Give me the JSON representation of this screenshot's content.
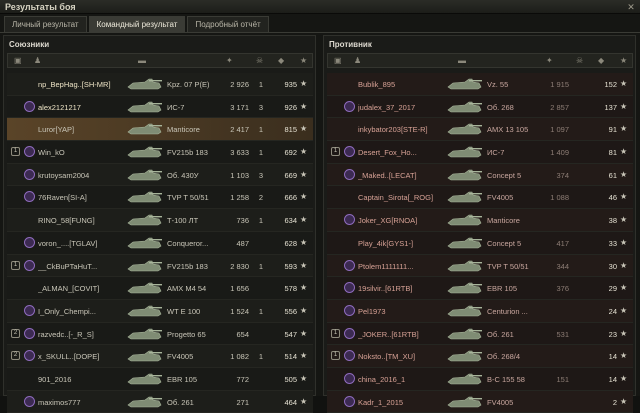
{
  "window": {
    "title": "Результаты боя",
    "close_icon": "close-icon"
  },
  "tabs": [
    {
      "label": "Личный результат",
      "active": false
    },
    {
      "label": "Командный результат",
      "active": true
    },
    {
      "label": "Подробный отчёт",
      "active": false
    }
  ],
  "allies": {
    "title": "Союзники",
    "rows": [
      {
        "name": "np_BepHag..[SH-MR]",
        "tank": "Kpz. 07 P(E)",
        "damage": "2 926",
        "frags": "1",
        "xp": "935",
        "platoon": "",
        "badge": false
      },
      {
        "name": "alex2121217",
        "tank": "ИС-7",
        "damage": "3 171",
        "frags": "3",
        "xp": "926",
        "platoon": "",
        "badge": true
      },
      {
        "name": "Luror[YAP]",
        "tank": "Manticore",
        "damage": "2 417",
        "frags": "1",
        "xp": "815",
        "platoon": "",
        "badge": false,
        "me": true
      },
      {
        "name": "Win_kO",
        "tank": "FV215b 183",
        "damage": "3 633",
        "frags": "1",
        "xp": "692",
        "platoon": "1",
        "badge": true
      },
      {
        "name": "krutoysam2004",
        "tank": "Об. 430У",
        "damage": "1 103",
        "frags": "3",
        "xp": "669",
        "platoon": "",
        "badge": true
      },
      {
        "name": "76Raven[SI-A]",
        "tank": "TVP T 50/51",
        "damage": "1 258",
        "frags": "2",
        "xp": "666",
        "platoon": "",
        "badge": true
      },
      {
        "name": "RINO_58[FUNG]",
        "tank": "Т-100 ЛТ",
        "damage": "736",
        "frags": "1",
        "xp": "634",
        "platoon": "",
        "badge": false
      },
      {
        "name": "voron_....[TGLAV]",
        "tank": "Conqueror...",
        "damage": "487",
        "frags": "",
        "xp": "628",
        "platoon": "",
        "badge": true
      },
      {
        "name": "__CkBuPTaHuT...",
        "tank": "FV215b 183",
        "damage": "2 830",
        "frags": "1",
        "xp": "593",
        "platoon": "1",
        "badge": true
      },
      {
        "name": "_ALMAN_[COVIT]",
        "tank": "AMX M4 54",
        "damage": "1 656",
        "frags": "",
        "xp": "578",
        "platoon": "",
        "badge": false
      },
      {
        "name": "I_Only_Chempi...",
        "tank": "WT E 100",
        "damage": "1 524",
        "frags": "1",
        "xp": "556",
        "platoon": "",
        "badge": true
      },
      {
        "name": "razvedc..[-_R_S]",
        "tank": "Progetto 65",
        "damage": "654",
        "frags": "",
        "xp": "547",
        "platoon": "2",
        "badge": true
      },
      {
        "name": "x_SKULL..[DOPE]",
        "tank": "FV4005",
        "damage": "1 082",
        "frags": "1",
        "xp": "514",
        "platoon": "2",
        "badge": true
      },
      {
        "name": "901_2016",
        "tank": "EBR 105",
        "damage": "772",
        "frags": "",
        "xp": "505",
        "platoon": "",
        "badge": false
      },
      {
        "name": "maximos777",
        "tank": "Об. 261",
        "damage": "271",
        "frags": "",
        "xp": "464",
        "platoon": "",
        "badge": true
      }
    ]
  },
  "enemies": {
    "title": "Противник",
    "rows": [
      {
        "name": "Bublik_895",
        "tank": "Vz. 55",
        "damage": "1 915",
        "frags": "",
        "xp": "152",
        "platoon": "",
        "badge": false
      },
      {
        "name": "judalex_37_2017",
        "tank": "Об. 268",
        "damage": "2 857",
        "frags": "",
        "xp": "137",
        "platoon": "",
        "badge": true
      },
      {
        "name": "inkybator203[STE-R]",
        "tank": "AMX 13 105",
        "damage": "1 097",
        "frags": "",
        "xp": "91",
        "platoon": "",
        "badge": false
      },
      {
        "name": "Desert_Fox_Ho...",
        "tank": "ИС-7",
        "damage": "1 409",
        "frags": "",
        "xp": "81",
        "platoon": "1",
        "badge": true
      },
      {
        "name": "_Maked..[LECAT]",
        "tank": "Concept 5",
        "damage": "374",
        "frags": "",
        "xp": "61",
        "platoon": "",
        "badge": true
      },
      {
        "name": "Captain_Sirota[_ROG]",
        "tank": "FV4005",
        "damage": "1 088",
        "frags": "",
        "xp": "46",
        "platoon": "",
        "badge": false
      },
      {
        "name": "Joker_XG[RNOA]",
        "tank": "Manticore",
        "damage": "",
        "frags": "",
        "xp": "38",
        "platoon": "",
        "badge": true
      },
      {
        "name": "Play_4ik[GYS1-]",
        "tank": "Concept 5",
        "damage": "417",
        "frags": "",
        "xp": "33",
        "platoon": "",
        "badge": false
      },
      {
        "name": "Ptolem1111111...",
        "tank": "TVP T 50/51",
        "damage": "344",
        "frags": "",
        "xp": "30",
        "platoon": "",
        "badge": true
      },
      {
        "name": "19silvir..[61RTB]",
        "tank": "EBR 105",
        "damage": "376",
        "frags": "",
        "xp": "29",
        "platoon": "",
        "badge": true
      },
      {
        "name": "Pel1973",
        "tank": "Centurion ...",
        "damage": "",
        "frags": "",
        "xp": "24",
        "platoon": "",
        "badge": true
      },
      {
        "name": "_JOKER..[61RTB]",
        "tank": "Об. 261",
        "damage": "531",
        "frags": "",
        "xp": "23",
        "platoon": "1",
        "badge": true
      },
      {
        "name": "Noksto..[TM_XU]",
        "tank": "Об. 268/4",
        "damage": "",
        "frags": "",
        "xp": "14",
        "platoon": "1",
        "badge": true
      },
      {
        "name": "china_2016_1",
        "tank": "В-С 155 58",
        "damage": "151",
        "frags": "",
        "xp": "14",
        "platoon": "",
        "badge": true
      },
      {
        "name": "Kadr_1_2015",
        "tank": "FV4005",
        "damage": "",
        "frags": "",
        "xp": "2",
        "platoon": "",
        "badge": true
      }
    ]
  },
  "star_glyph": "★"
}
